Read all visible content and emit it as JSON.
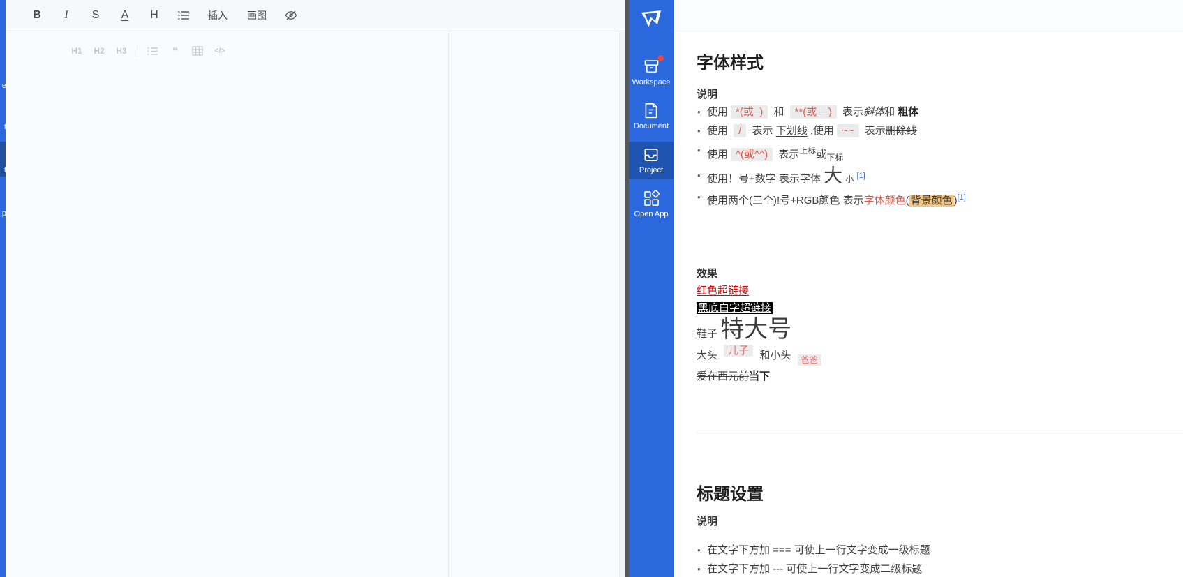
{
  "colors": {
    "sidebar_blue": "#2b67dd",
    "sidebar_active": "#1f54b0",
    "badge_red": "#f4473c",
    "code_red": "#e2574c",
    "link_blue": "#3f6fd8",
    "highlight_orange": "#f3c57f",
    "red_link": "#e60000"
  },
  "left_window": {
    "toolbar": {
      "bold": "B",
      "italic": "I",
      "strikethrough": "S",
      "font_color": "A",
      "heading": "H",
      "insert": "插入",
      "draw": "画图"
    },
    "format_bar": {
      "h1": "H1",
      "h2": "H2",
      "h3": "H3",
      "quote": "❝",
      "code": "</>"
    },
    "sliver_fragments": {
      "f0": "e",
      "f1": "t",
      "f2": "t",
      "f3": "p"
    }
  },
  "sidebar": {
    "logo": "app-logo",
    "items": [
      {
        "label": "Workspace",
        "icon": "workspace-icon",
        "badge": true
      },
      {
        "label": "Document",
        "icon": "document-icon"
      },
      {
        "label": "Project",
        "icon": "project-icon",
        "active": true
      },
      {
        "label": "Open App",
        "icon": "open-app-icon"
      }
    ]
  },
  "content": {
    "font_section": {
      "title": "字体样式",
      "subtitle": "说明",
      "bullets": [
        [
          {
            "t": "使用"
          },
          {
            "t": "*(或_)",
            "c": "code"
          },
          {
            "t": " 和 "
          },
          {
            "t": "**(或__)",
            "c": "code"
          },
          {
            "t": " 表示"
          },
          {
            "t": "斜体",
            "c": "italic"
          },
          {
            "t": "和 "
          },
          {
            "t": "粗体",
            "c": "bold"
          }
        ],
        [
          {
            "t": "使用 "
          },
          {
            "t": "/",
            "c": "code"
          },
          {
            "t": " 表示 "
          },
          {
            "t": "下划线",
            "c": "underline"
          },
          {
            "t": " ,使用"
          },
          {
            "t": "~~",
            "c": "code"
          },
          {
            "t": " 表示"
          },
          {
            "t": "删除线",
            "c": "strike"
          }
        ],
        [
          {
            "t": "使用"
          },
          {
            "t": "^(或^^)",
            "c": "code"
          },
          {
            "t": " 表示"
          },
          {
            "t": "上标",
            "c": "sup"
          },
          {
            "t": "或"
          },
          {
            "t": "下标",
            "c": "sub"
          }
        ],
        [
          {
            "t": "使用！号+数字 表示字体 "
          },
          {
            "t": "大",
            "c": "big"
          },
          {
            "t": " "
          },
          {
            "t": "小",
            "c": "small"
          },
          {
            "t": " "
          },
          {
            "t": "[1]",
            "c": "fnlink",
            "n": "footnote-link-1",
            "i": true
          }
        ],
        [
          {
            "t": "使用两个(三个)!号+RGB颜色 表示"
          },
          {
            "t": "字体颜色",
            "c": "red"
          },
          {
            "t": "("
          },
          {
            "t": "背景颜色",
            "c": "hl"
          },
          {
            "t": ")"
          },
          {
            "t": "[1]",
            "c": "fnlink",
            "n": "footnote-link-2",
            "i": true
          }
        ]
      ]
    },
    "effects": {
      "label": "效果",
      "lines": [
        [
          {
            "t": "红色超链接",
            "c": "redlink",
            "n": "red-hyperlink",
            "i": true
          }
        ],
        [
          {
            "t": "黑底白字超链接",
            "c": "inverse",
            "n": "black-bg-hyperlink",
            "i": true
          }
        ],
        [
          {
            "t": "鞋子 "
          },
          {
            "t": "特大号",
            "c": "xlarge"
          }
        ],
        [
          {
            "t": "大头 "
          },
          {
            "t": "儿子",
            "c": "rubysup"
          },
          {
            "t": " 和小头 "
          },
          {
            "t": "爸爸",
            "c": "rubysub"
          }
        ],
        [
          {
            "t": "爱在西元前",
            "c": "strike"
          },
          {
            "t": "当下",
            "c": "bold"
          }
        ]
      ]
    },
    "heading_section": {
      "title": "标题设置",
      "subtitle": "说明",
      "bullets": [
        [
          {
            "t": "在文字下方加 === 可使上一行文字变成一级标题"
          }
        ],
        [
          {
            "t": "在文字下方加 --- 可使上一行文字变成二级标题"
          }
        ]
      ]
    }
  }
}
